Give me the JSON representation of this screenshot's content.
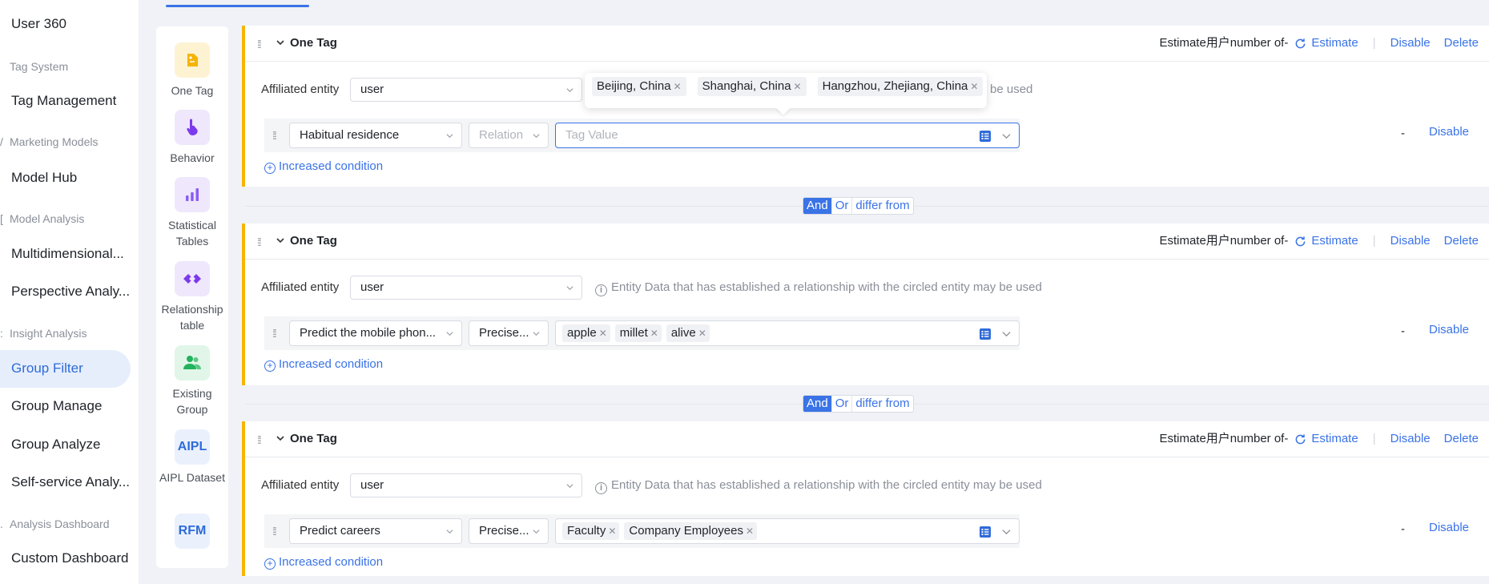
{
  "sidebar": {
    "items": [
      {
        "label": "User 360",
        "type": "item"
      },
      {
        "label": "Tag System",
        "type": "group"
      },
      {
        "label": "Tag Management",
        "type": "item"
      },
      {
        "label": "Marketing Models",
        "type": "group"
      },
      {
        "label": "Model Hub",
        "type": "item"
      },
      {
        "label": "Model Analysis",
        "type": "group"
      },
      {
        "label": "Multidimensional...",
        "type": "item"
      },
      {
        "label": "Perspective Analy...",
        "type": "item"
      },
      {
        "label": "Insight Analysis",
        "type": "group"
      },
      {
        "label": "Group Filter",
        "type": "item",
        "active": true
      },
      {
        "label": "Group Manage",
        "type": "item"
      },
      {
        "label": "Group Analyze",
        "type": "item"
      },
      {
        "label": "Self-service Analy...",
        "type": "item"
      },
      {
        "label": "Analysis Dashboard",
        "type": "group"
      },
      {
        "label": "Custom Dashboard",
        "type": "item"
      }
    ]
  },
  "palette": [
    {
      "label": "One Tag",
      "icon": "tag-icon",
      "bg": "#fdf3d2",
      "color": "#f5b400"
    },
    {
      "label": "Behavior",
      "icon": "pointer-hand-icon",
      "bg": "#efe7fb",
      "color": "#7c3aed"
    },
    {
      "label": "Statistical Tables",
      "icon": "bar-chart-icon",
      "bg": "#efe7fb",
      "color": "#8b5cf6"
    },
    {
      "label": "Relationship table",
      "icon": "relationship-icon",
      "bg": "#efe7fb",
      "color": "#7c3aed"
    },
    {
      "label": "Existing Group",
      "icon": "group-icon",
      "bg": "#e1f6e8",
      "color": "#22b35e"
    },
    {
      "label": "AIPL Dataset",
      "icon": "aipl-icon",
      "icon_text": "AIPL",
      "bg": "#eaf1fd",
      "color": "#2f6bd8"
    },
    {
      "label": "",
      "icon": "rfm-icon",
      "icon_text": "RFM",
      "bg": "#eaf1fd",
      "color": "#2f6bd8"
    }
  ],
  "common": {
    "block_title": "One Tag",
    "estimate_label": "Estimate用户number of-",
    "estimate_link": "Estimate",
    "disable": "Disable",
    "delete": "Delete",
    "affiliated_entity": "Affiliated entity",
    "entity_value": "user",
    "info_text": "Entity Data that has established a relationship with the circled entity may be used",
    "info_partial": "be used",
    "increased_condition": "Increased condition",
    "dash": "-",
    "tag_value_placeholder": "Tag Value"
  },
  "logic": {
    "and": "And",
    "or": "Or",
    "differ": "differ from"
  },
  "blocks": [
    {
      "tag": "Habitual residence",
      "relation": "Relation",
      "relation_placeholder": true,
      "values": [],
      "popover_values": [
        "Beijing, China",
        "Shanghai, China",
        "Hangzhou, Zhejiang, China"
      ]
    },
    {
      "tag": "Predict the mobile phon...",
      "relation": "Precise...",
      "relation_placeholder": false,
      "values": [
        "apple",
        "millet",
        "alive"
      ]
    },
    {
      "tag": "Predict careers",
      "relation": "Precise...",
      "relation_placeholder": false,
      "values": [
        "Faculty",
        "Company Employees"
      ]
    }
  ]
}
